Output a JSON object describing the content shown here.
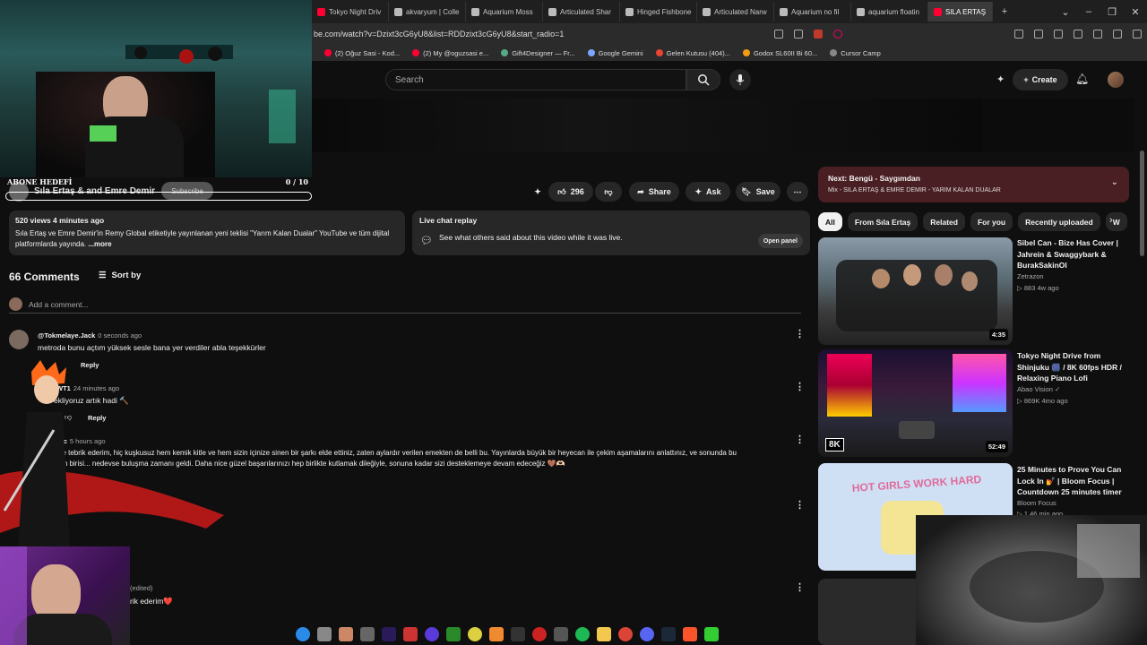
{
  "browser": {
    "tabs": [
      {
        "label": "Tokyo Night Driv",
        "favicon": "youtube"
      },
      {
        "label": "akvaryum | Colle",
        "favicon": "page"
      },
      {
        "label": "Aquarium Moss",
        "favicon": "page"
      },
      {
        "label": "Articulated Shar",
        "favicon": "page"
      },
      {
        "label": "Hinged Fishbone",
        "favicon": "page"
      },
      {
        "label": "Articulated Narw",
        "favicon": "page"
      },
      {
        "label": "Aquarium no fil",
        "favicon": "page"
      },
      {
        "label": "aquarium floatin",
        "favicon": "page"
      }
    ],
    "active_tab": "SILA ERTAŞ",
    "new_tab": "+",
    "url": "be.com/watch?v=Dzixt3cG6yU8&list=RDDzixt3cG6yU8&start_radio=1",
    "bookmarks": [
      "(2) Oğuz Sasi - Kod...",
      "(2) My @oguzsasi e...",
      "Gift4Designer — Fr...",
      "Google Gemini",
      "Gelen Kutusu (404)...",
      "Godox SL60II Bi 60...",
      "Cursor Camp"
    ]
  },
  "header": {
    "search_placeholder": "Search",
    "create_label": "Create"
  },
  "video": {
    "channel": "Sıla Ertaş & and Emre Demir",
    "subscribe_label": "Subscribe",
    "likes": "296",
    "share_label": "Share",
    "ask_label": "Ask",
    "save_label": "Save"
  },
  "description": {
    "meta": "520 views  4 minutes ago",
    "text": "Sıla Ertaş ve Emre Demir'in Remy Global etiketiyle yayınlanan yeni teklisi \"Yarım Kalan Dualar\" YouTube ve tüm dijital platformlarda yayında.",
    "more": "...more"
  },
  "live_chat": {
    "title": "Live chat replay",
    "text": "See what others said about this video while it was live.",
    "button": "Open panel"
  },
  "comments": {
    "count_label": "66 Comments",
    "sort_label": "Sort by",
    "add_placeholder": "Add a comment...",
    "reply_label": "Reply",
    "items": [
      {
        "user": "@Tokmelaye.Jack",
        "time": "0 seconds ago",
        "text": "metroda bunu açtım yüksek sesle bana yer verdiler abla teşekkürler"
      },
      {
        "user": "WT1",
        "time": "24 minutes ago",
        "text": "ekliyoruz artık hadi 🔨"
      },
      {
        "user": "n-t2c",
        "time": "5 hours ago",
        "text": "zi de tebrik ederim, hiç kuşkusuz hem kemik kitle ve hem sizin içinize sinen bir şarkı elde ettiniz, zaten aylardır verilen emekten de belli bu. Yayınlarda büyük bir heyecan ile çekim aşamalarını anlattınız, ve sonunda bu",
        "text2": "erin birisi... nedevse buluşma zamanı geldi. Daha nice güzel başarılarınızı hep birlikte kutlamak dileğiyle, sonuna kadar sizi desteklemeye devam edeceğiz 🤎🫶🏻"
      },
      {
        "user": "(edited)",
        "time": "",
        "text": "rik ederim❤️"
      }
    ]
  },
  "up_next": {
    "title": "Next: Bengü - Saygımdan",
    "subtitle": "Mix - SILA ERTAŞ & EMRE DEMIR - YARIM KALAN DUALAR"
  },
  "chips": [
    "All",
    "From Sıla Ertaş",
    "Related",
    "For you",
    "Recently uploaded",
    "W"
  ],
  "related": [
    {
      "title": "Sibel Can - Bize Has Cover | Jahrein & Swaggybark & BurakSakinOl",
      "channel": "Zetrazon",
      "meta": "▷ 883   4w ago",
      "duration": "4:35"
    },
    {
      "title": "Tokyo Night Drive from Shinjuku 🎆 / 8K 60fps HDR / Relaxing Piano Lofi",
      "channel": "Abao Vision ✓",
      "meta": "▷ 869K   4mo ago",
      "duration": "52:49",
      "badge": "8K"
    },
    {
      "title": "25 Minutes to Prove You Can Lock In 💅 | Bloom Focus | Countdown 25 minutes timer",
      "channel": "Bloom Focus",
      "meta": "▷ 1  46 min ago",
      "duration": "",
      "thumb_text": "HOT GIRLS WORK HARD"
    }
  ],
  "overlay": {
    "goal_label": "ABONE HEDEFİ",
    "goal_count": "0 / 10",
    "goal_progress": 0
  },
  "colors": {
    "background": "#0f0f0f",
    "surface": "#272727",
    "up_next_bg": "#4a1f23",
    "accent_red": "#ff0033"
  }
}
